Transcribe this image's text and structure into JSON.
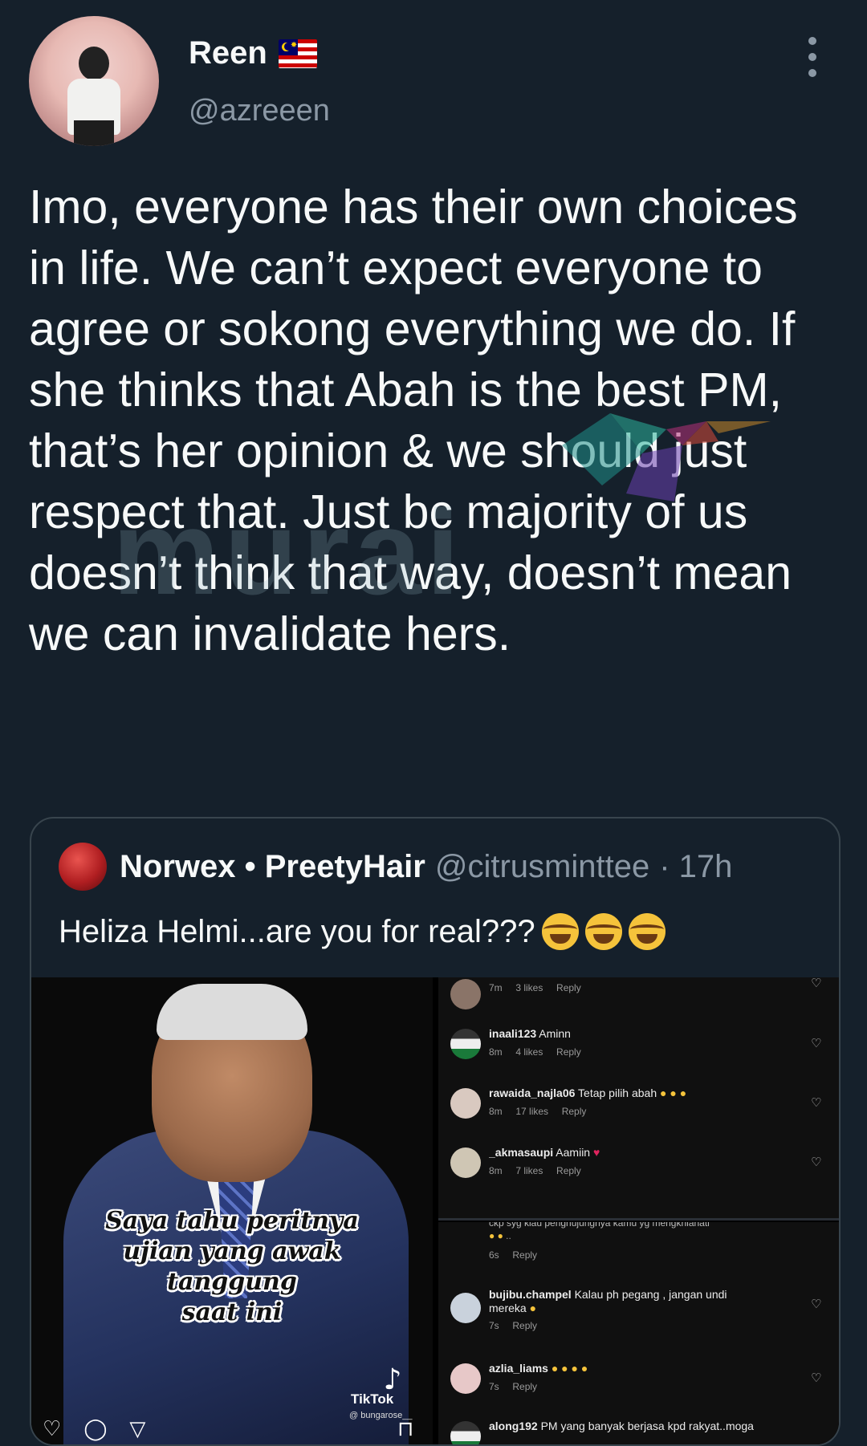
{
  "header": {
    "display_name": "Reen",
    "handle": "@azreeen"
  },
  "tweet": {
    "text": "Imo, everyone has their own choices in life. We can’t expect everyone to agree or sokong everything we do. If she thinks that Abah is the best PM, that’s her opinion & we should just respect that. Just bc majority of us doesn’t think that way, doesn’t mean we can invalidate hers."
  },
  "watermark": {
    "text": "murai"
  },
  "quote": {
    "name": "Norwex • PreetyHair",
    "handle": "@citrusminttee",
    "time": "· 17h",
    "text": "Heliza Helmi...are you for real???"
  },
  "media": {
    "caption_lines": [
      "Saya tahu peritnya",
      "ujian yang awak",
      "tanggung",
      "saat ini"
    ],
    "tiktok_label": "TikTok",
    "tiktok_user": "@ bungarose__",
    "panel1": [
      {
        "user": "",
        "text": "",
        "time": "7m",
        "likes": "3 likes",
        "reply": "Reply"
      },
      {
        "user": "inaali123",
        "text": "Aminn",
        "time": "8m",
        "likes": "4 likes",
        "reply": "Reply"
      },
      {
        "user": "rawaida_najla06",
        "text": "Tetap pilih abah",
        "time": "8m",
        "likes": "17 likes",
        "reply": "Reply"
      },
      {
        "user": "_akmasaupi",
        "text": "Aamiin",
        "time": "8m",
        "likes": "7 likes",
        "reply": "Reply"
      }
    ],
    "panel2": [
      {
        "user": "",
        "text": "ckp syg kiau pengnujungnya kamu yg mengkhianati",
        "time": "6s",
        "likes": "",
        "reply": "Reply"
      },
      {
        "user": "bujibu.champel",
        "text": "Kalau ph pegang , jangan undi mereka",
        "time": "7s",
        "likes": "",
        "reply": "Reply"
      },
      {
        "user": "azlia_liams",
        "text": "",
        "time": "7s",
        "likes": "",
        "reply": "Reply"
      },
      {
        "user": "along192",
        "text": "PM yang banyak berjasa kpd rakyat..moga",
        "time": "",
        "likes": "",
        "reply": ""
      }
    ]
  }
}
